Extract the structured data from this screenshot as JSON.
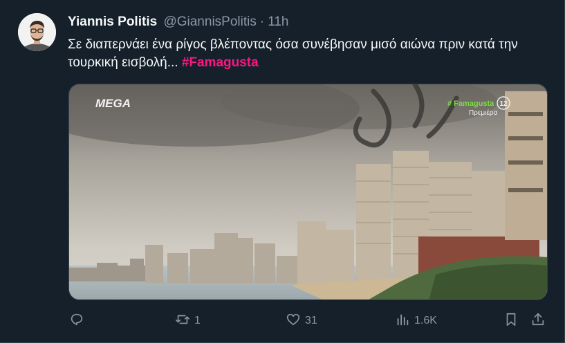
{
  "tweet": {
    "author_name": "Yiannis Politis",
    "handle": "@GiannisPolitis",
    "separator": "·",
    "time": "11h",
    "text": "Σε διαπερνάει ένα ρίγος βλέποντας όσα συνέβησαν μισό αιώνα πριν κατά την τουρκική εισβολή...",
    "hashtag": "#Famagusta"
  },
  "media": {
    "channel_logo": "MEGA",
    "overlay_tag": "# Famagusta",
    "overlay_sub": "Πρεμιέρα",
    "rating": "12"
  },
  "actions": {
    "reply_count": "",
    "retweet_count": "1",
    "like_count": "31",
    "views_count": "1.6K"
  },
  "colors": {
    "background": "#15202b",
    "hashtag": "#f91880",
    "muted": "#8b98a5"
  },
  "icons": [
    "reply-icon",
    "retweet-icon",
    "like-icon",
    "views-icon",
    "bookmark-icon",
    "share-icon"
  ]
}
